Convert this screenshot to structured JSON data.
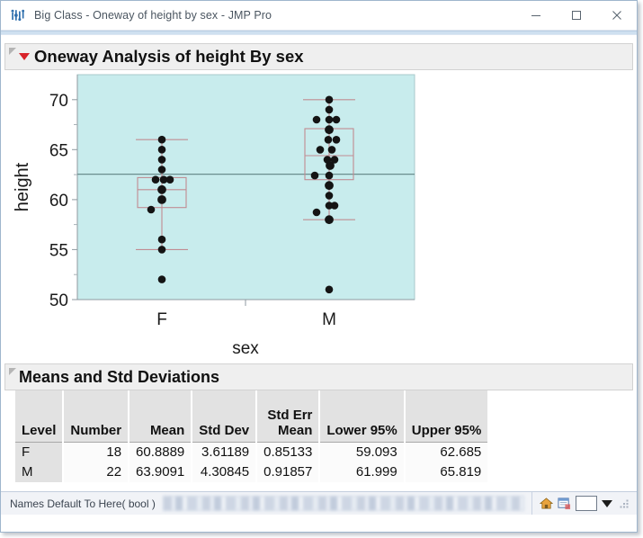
{
  "window": {
    "title": "Big Class - Oneway of height by sex - JMP Pro",
    "logo_icon": "jmp-logo-icon",
    "minimize_icon": "minimize-icon",
    "maximize_icon": "maximize-icon",
    "close_icon": "close-icon"
  },
  "report": {
    "oneway_title": "Oneway Analysis of height By sex",
    "means_title": "Means and Std Deviations"
  },
  "chart_data": {
    "type": "scatter",
    "title": "Oneway Analysis of height By sex",
    "xlabel": "sex",
    "ylabel": "height",
    "categories": [
      "F",
      "M"
    ],
    "yticks": [
      50,
      55,
      60,
      65,
      70
    ],
    "ylim": [
      49.0,
      71.5
    ],
    "grid": false,
    "plot_background": "#c8eced",
    "marker_color": "#1a1a1a",
    "box_color": "#c08b92",
    "grand_mean": 62.55,
    "grand_mean_line_color": "#6b8e8e",
    "series": [
      {
        "name": "F",
        "n": 18,
        "values": [
          66,
          65,
          64,
          63,
          62,
          62,
          62,
          61,
          61,
          60,
          60,
          59,
          56,
          55,
          55,
          52,
          62,
          61
        ],
        "box": {
          "min_whisker": 55,
          "q1": 59.75,
          "median": 61.5,
          "q3": 62.75,
          "max_whisker": 66
        }
      },
      {
        "name": "M",
        "n": 22,
        "values": [
          70,
          69,
          68,
          68,
          68,
          67,
          66,
          66,
          65,
          65,
          65,
          64,
          64,
          64,
          64,
          63,
          63,
          62,
          61,
          60,
          59,
          58,
          51
        ],
        "box": {
          "min_whisker": 58,
          "q1": 62.0,
          "median": 64.4,
          "q3": 67.1,
          "max_whisker": 70
        }
      }
    ]
  },
  "means_table": {
    "headers": [
      "Level",
      "Number",
      "Mean",
      "Std Dev",
      "Std Err\nMean",
      "Lower 95%",
      "Upper 95%"
    ],
    "rows": [
      {
        "level": "F",
        "number": "18",
        "mean": "60.8889",
        "std_dev": "3.61189",
        "std_err_mean": "0.85133",
        "lower_95": "59.093",
        "upper_95": "62.685"
      },
      {
        "level": "M",
        "number": "22",
        "mean": "63.9091",
        "std_dev": "4.30845",
        "std_err_mean": "0.91857",
        "lower_95": "61.999",
        "upper_95": "65.819"
      }
    ]
  },
  "status_bar": {
    "script_text": "Names Default To Here( bool )",
    "home_icon": "home-icon",
    "script_window_icon": "script-window-icon",
    "dropdown_icon": "dropdown-triangle-icon",
    "resize_grip_icon": "resize-grip-icon"
  }
}
